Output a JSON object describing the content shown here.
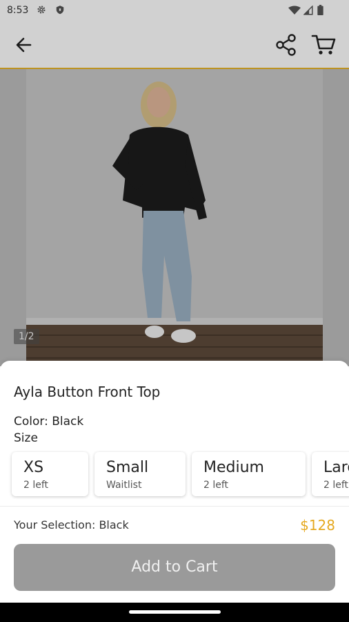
{
  "status": {
    "time": "8:53",
    "icons": [
      "gear-icon",
      "shield-icon",
      "wifi-icon",
      "signal-icon",
      "battery-icon"
    ]
  },
  "header": {
    "icons": [
      "back-arrow-icon",
      "share-icon",
      "cart-icon"
    ],
    "accent_color": "#e7b325"
  },
  "gallery": {
    "counter": "1/2"
  },
  "product": {
    "title": "Ayla Button Front Top",
    "color_label": "Color: Black",
    "size_label": "Size",
    "sizes": [
      {
        "name": "XS",
        "stock": "2 left"
      },
      {
        "name": "Small",
        "stock": "Waitlist"
      },
      {
        "name": "Medium",
        "stock": "2 left"
      },
      {
        "name": "Large",
        "stock": "2 left"
      }
    ]
  },
  "footer": {
    "selection": "Your Selection: Black",
    "price": "$128",
    "price_color": "#e5a81f",
    "add_to_cart": "Add to Cart"
  }
}
